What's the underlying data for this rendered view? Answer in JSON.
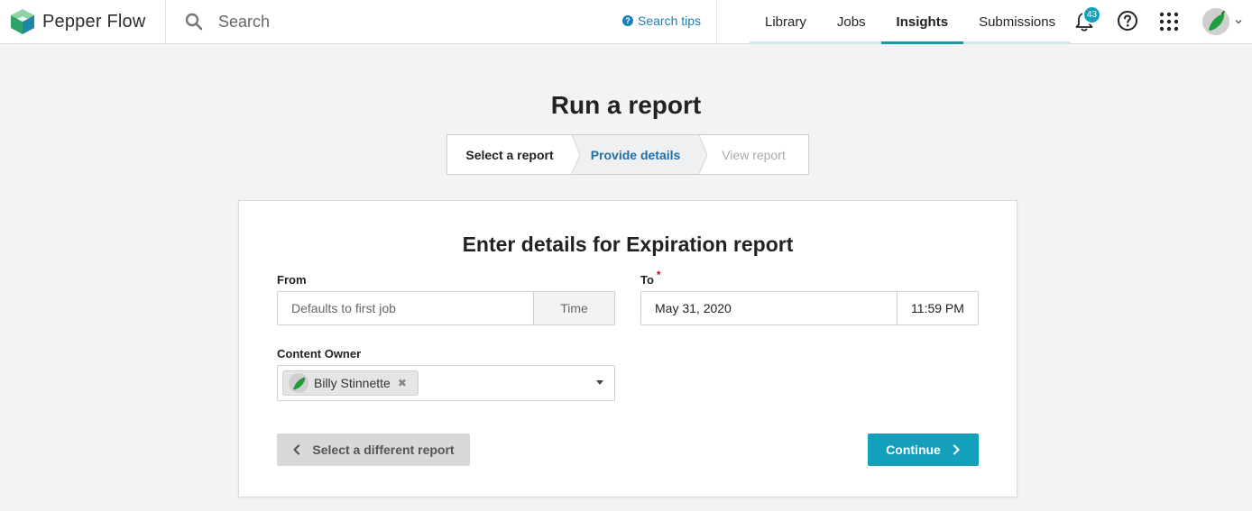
{
  "app": {
    "name": "Pepper Flow"
  },
  "search": {
    "placeholder": "Search",
    "tips_label": "Search tips"
  },
  "nav": {
    "tabs": [
      {
        "label": "Library"
      },
      {
        "label": "Jobs"
      },
      {
        "label": "Insights",
        "active": true
      },
      {
        "label": "Submissions"
      }
    ],
    "notifications_count": "43"
  },
  "page": {
    "title": "Run a report",
    "steps": [
      {
        "label": "Select a report",
        "state": "done"
      },
      {
        "label": "Provide details",
        "state": "current"
      },
      {
        "label": "View report",
        "state": "upcoming"
      }
    ]
  },
  "form": {
    "title": "Enter details for Expiration report",
    "from": {
      "label": "From",
      "date_placeholder": "Defaults to first job",
      "time_placeholder": "Time"
    },
    "to": {
      "label": "To",
      "required_mark": "*",
      "date_value": "May 31, 2020",
      "time_value": "11:59 PM"
    },
    "owner": {
      "label": "Content Owner",
      "selected": "Billy Stinnette"
    },
    "back_button": "Select a different report",
    "continue_button": "Continue"
  },
  "colors": {
    "accent": "#14a0bb",
    "link": "#1a7fb5",
    "required": "#d0021b"
  }
}
